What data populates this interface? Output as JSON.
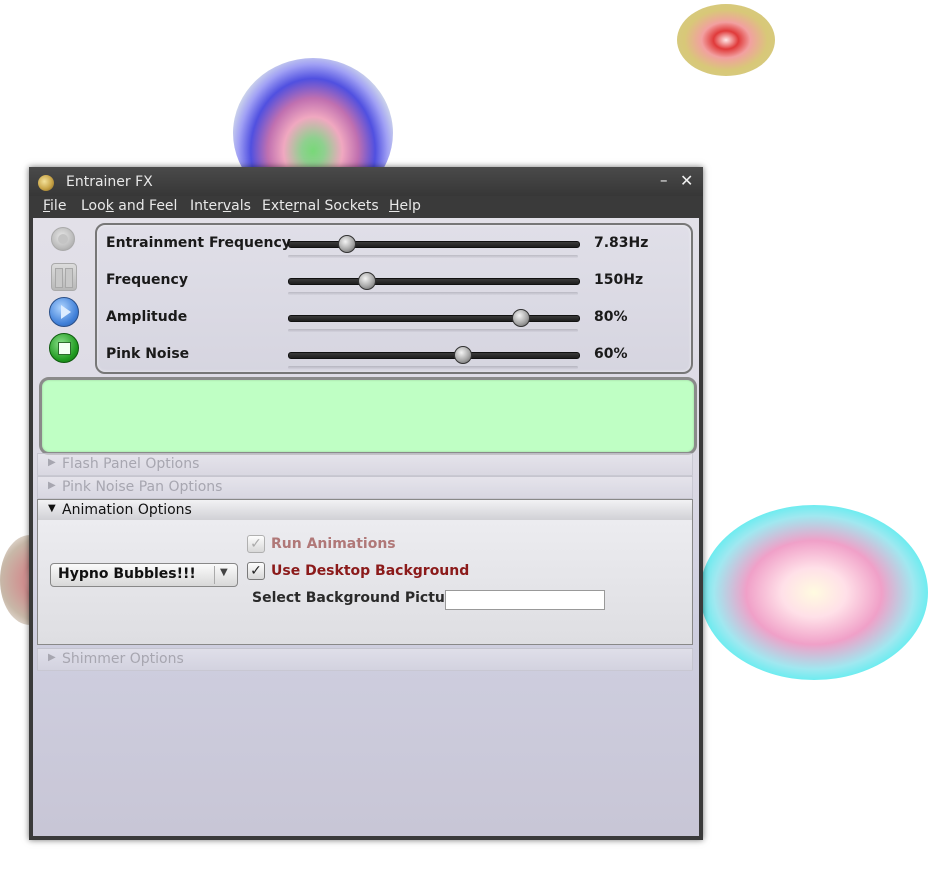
{
  "window": {
    "title": "Entrainer FX",
    "minimize_glyph": "–",
    "close_glyph": "✕"
  },
  "menu": {
    "file": {
      "pre": "",
      "mnemonic": "F",
      "post": "ile"
    },
    "look_and_feel": {
      "pre": "Loo",
      "mnemonic": "k",
      "post": " and Feel"
    },
    "intervals": {
      "pre": "Inter",
      "mnemonic": "v",
      "post": "als"
    },
    "external_sockets": {
      "pre": "Exte",
      "mnemonic": "r",
      "post": "nal Sockets"
    },
    "help": {
      "pre": "",
      "mnemonic": "H",
      "post": "elp"
    }
  },
  "transport": {
    "record_enabled": false,
    "pause_enabled": false,
    "play_enabled": true,
    "stop_enabled": true
  },
  "sliders": [
    {
      "label": "Entrainment Frequency",
      "value": "7.83Hz",
      "position": 0.2
    },
    {
      "label": "Frequency",
      "value": "150Hz",
      "position": 0.27
    },
    {
      "label": "Amplitude",
      "value": "80%",
      "position": 0.8
    },
    {
      "label": "Pink Noise",
      "value": "60%",
      "position": 0.6
    }
  ],
  "flash_panel_color": "#bfffc4",
  "sections": {
    "flash_panel": {
      "title": "Flash Panel Options",
      "expanded": false
    },
    "pink_noise_pan": {
      "title": "Pink Noise Pan Options",
      "expanded": false
    },
    "animation": {
      "title": "Animation Options",
      "expanded": true
    },
    "shimmer": {
      "title": "Shimmer Options",
      "expanded": false
    }
  },
  "animation": {
    "selected_animation": "Hypno Bubbles!!!",
    "run_animations": {
      "label": "Run Animations",
      "checked": true,
      "enabled": false,
      "glyph": "✓"
    },
    "use_desktop_background": {
      "label": "Use Desktop Background",
      "checked": true,
      "enabled": true,
      "glyph": "✓"
    },
    "background_picture_label": "Select Background Picture",
    "background_picture_value": ""
  }
}
